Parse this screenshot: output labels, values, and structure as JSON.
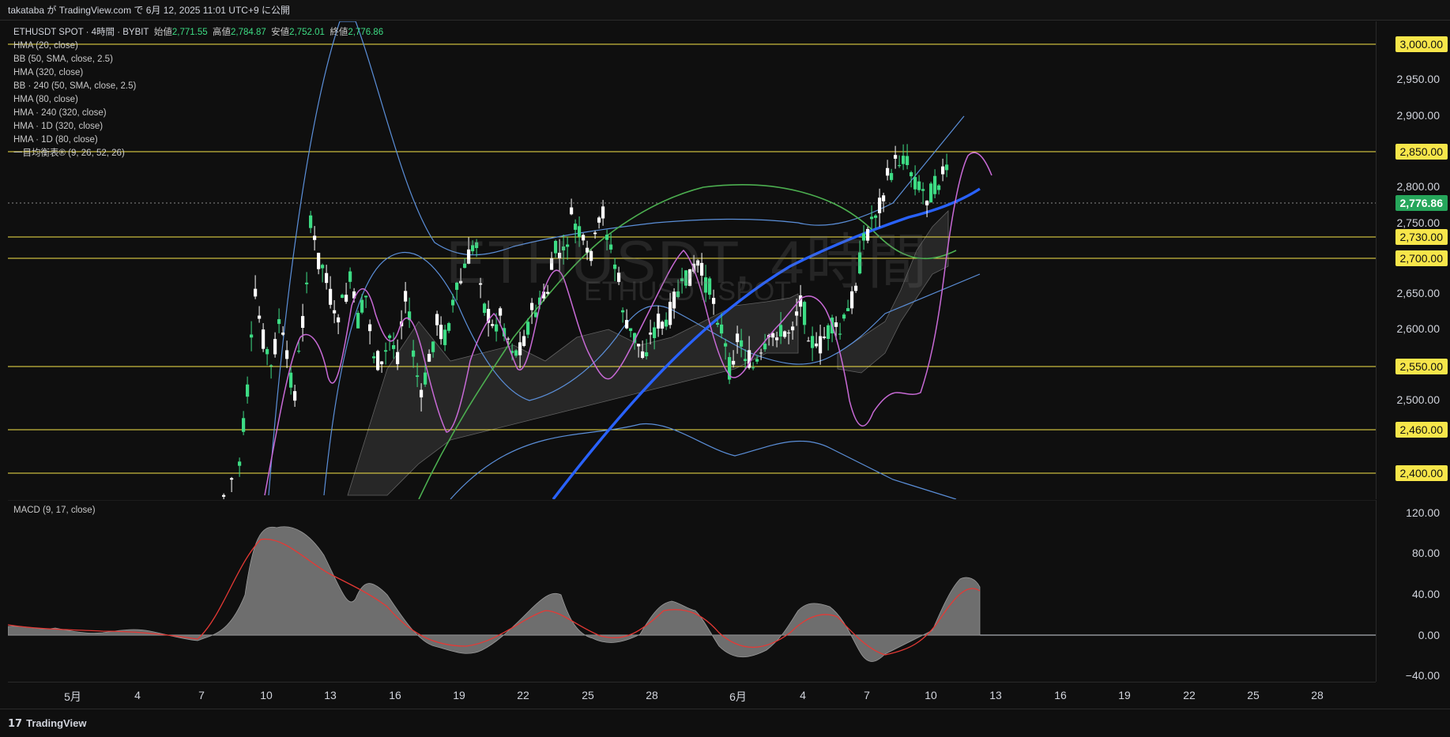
{
  "header": {
    "publish_text": "takataba が TradingView.com で 6月 12, 2025 11:01 UTC+9 に公開"
  },
  "legend": {
    "symbol": "ETHUSDT SPOT · 4時間 · BYBIT",
    "open_label": "始値",
    "open": "2,771.55",
    "high_label": "高値",
    "high": "2,784.87",
    "low_label": "安値",
    "low": "2,752.01",
    "close_label": "終値",
    "close": "2,776.86",
    "indicators": [
      "HMA (20, close)",
      "BB (50, SMA, close, 2.5)",
      "HMA (320, close)",
      "BB · 240 (50, SMA, close, 2.5)",
      "HMA (80, close)",
      "HMA · 240 (320, close)",
      "HMA · 1D (320, close)",
      "HMA · 1D (80, close)",
      "一目均衡表® (9, 26, 52, 26)"
    ]
  },
  "watermark": {
    "main": "ETHUSDT, 4時間",
    "sub": "ETHUSDT SPOT"
  },
  "price_axis": {
    "ticks": [
      "2,950.00",
      "2,900.00",
      "2,800.00",
      "2,750.00",
      "2,650.00",
      "2,600.00",
      "2,500.00"
    ],
    "highlighted_levels": [
      "3,000.00",
      "2,850.00",
      "2,730.00",
      "2,700.00",
      "2,550.00",
      "2,460.00",
      "2,400.00"
    ],
    "last_price": "2,776.86"
  },
  "macd": {
    "label": "MACD (9, 17, close)",
    "ticks": [
      "120.00",
      "80.00",
      "40.00",
      "0.00",
      "−40.00"
    ]
  },
  "time_axis": {
    "labels": [
      "5月",
      "4",
      "7",
      "10",
      "13",
      "16",
      "19",
      "22",
      "25",
      "28",
      "6月",
      "4",
      "7",
      "10",
      "13",
      "16",
      "19",
      "22",
      "25",
      "28"
    ]
  },
  "footer": {
    "brand": "TradingView"
  },
  "colors": {
    "bull": "#3ddc84",
    "bear": "#ffffff",
    "level_line": "#f7e64a",
    "hma_fast": "#c86ad6",
    "hma_slow": "#2962ff",
    "bb": "#5b8fd9",
    "green_ma": "#4caf50",
    "macd_signal": "#e53935",
    "macd_hist": "#6e6e6e"
  }
}
